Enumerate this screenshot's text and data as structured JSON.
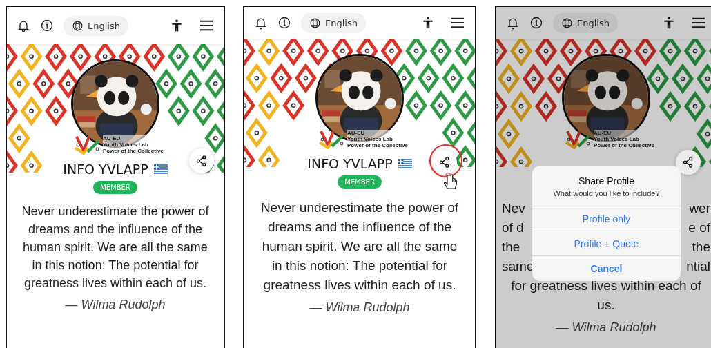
{
  "panels": [
    {
      "kind": "plain",
      "header": {
        "language": "English"
      },
      "logo_lines": [
        "AU-EU",
        "Youth Voices Lab",
        "Power of the Collective"
      ],
      "name": "INFO YVLAPP",
      "badge": "MEMBER",
      "share": {
        "highlighted": false
      },
      "quote": "Never underestimate the power of dreams and the influence of the human spirit. We are all the same in this notion: The potential for greatness lives within each of us.",
      "author": "— Wilma Rudolph"
    },
    {
      "kind": "plain",
      "header": {
        "language": "English"
      },
      "logo_lines": [
        "AU-EU",
        "Youth Voices Lab",
        "Power of the Collective"
      ],
      "name": "INFO YVLAPP",
      "badge": "MEMBER",
      "share": {
        "highlighted": true
      },
      "quote": "Never underestimate the power of dreams and the influence of the human spirit. We are all the same in this notion: The potential for greatness lives within each of us.",
      "author": "— Wilma Rudolph"
    },
    {
      "kind": "dialog",
      "header": {
        "language": "English"
      },
      "logo_lines": [
        "AU-EU",
        "Youth Voices Lab",
        "Power of the Collective"
      ],
      "share": {
        "highlighted": false
      },
      "quote_lines": [
        {
          "left": "Nev",
          "right": "wer"
        },
        {
          "left": "of d",
          "right": "e of"
        },
        {
          "left": "the",
          "right": "the"
        },
        {
          "left": "same",
          "right": "ntial"
        },
        {
          "text": "for greatness lives within each of"
        },
        {
          "text": "us."
        }
      ],
      "author": "— Wilma Rudolph",
      "dialog": {
        "title": "Share Profile",
        "message": "What would you like to include?",
        "actions": [
          {
            "label": "Profile only",
            "kind": "option"
          },
          {
            "label": "Profile + Quote",
            "kind": "option"
          },
          {
            "label": "Cancel",
            "kind": "cancel"
          }
        ]
      }
    }
  ]
}
